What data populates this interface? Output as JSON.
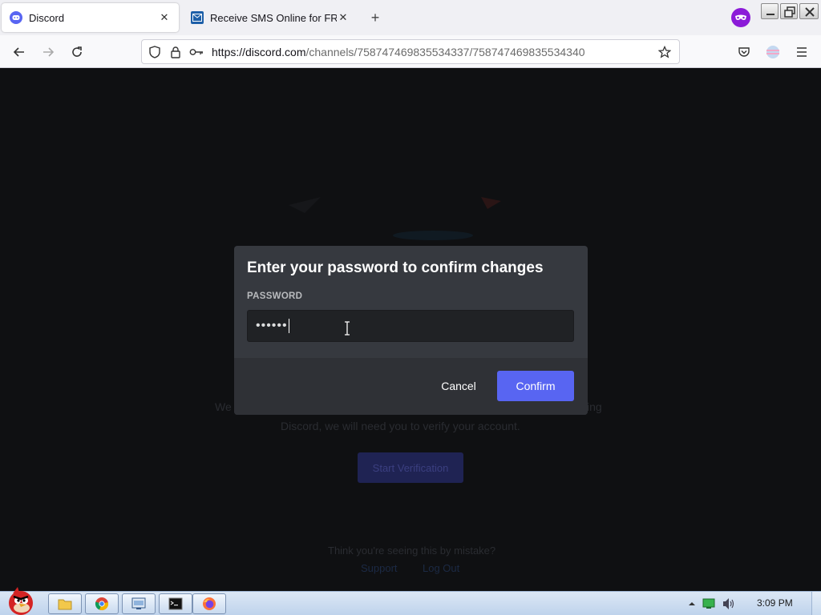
{
  "browser": {
    "tabs": [
      {
        "title": "Discord",
        "active": true,
        "icon": "discord-icon"
      },
      {
        "title": "Receive SMS Online for FREE",
        "active": false,
        "icon": "sms-site-icon"
      }
    ],
    "url_host": "https://discord.com",
    "url_path": "/channels/758747469835534337/758747469835534340"
  },
  "background_page": {
    "line1_left": "We",
    "line1_right": "ing",
    "line2": "Discord, we will need you to verify your account.",
    "button": "Start Verification",
    "footer_question": "Think you're seeing this by mistake?",
    "footer_link1": "Support",
    "footer_link2": "Log Out"
  },
  "modal": {
    "title": "Enter your password to confirm changes",
    "password_label": "PASSWORD",
    "password_value": "••••••",
    "cancel_label": "Cancel",
    "confirm_label": "Confirm"
  },
  "taskbar": {
    "time": "3:09 PM"
  },
  "colors": {
    "modal_bg": "#36393f",
    "modal_footer": "#2f3136",
    "confirm_bg": "#5865f2",
    "input_bg": "#202225"
  }
}
